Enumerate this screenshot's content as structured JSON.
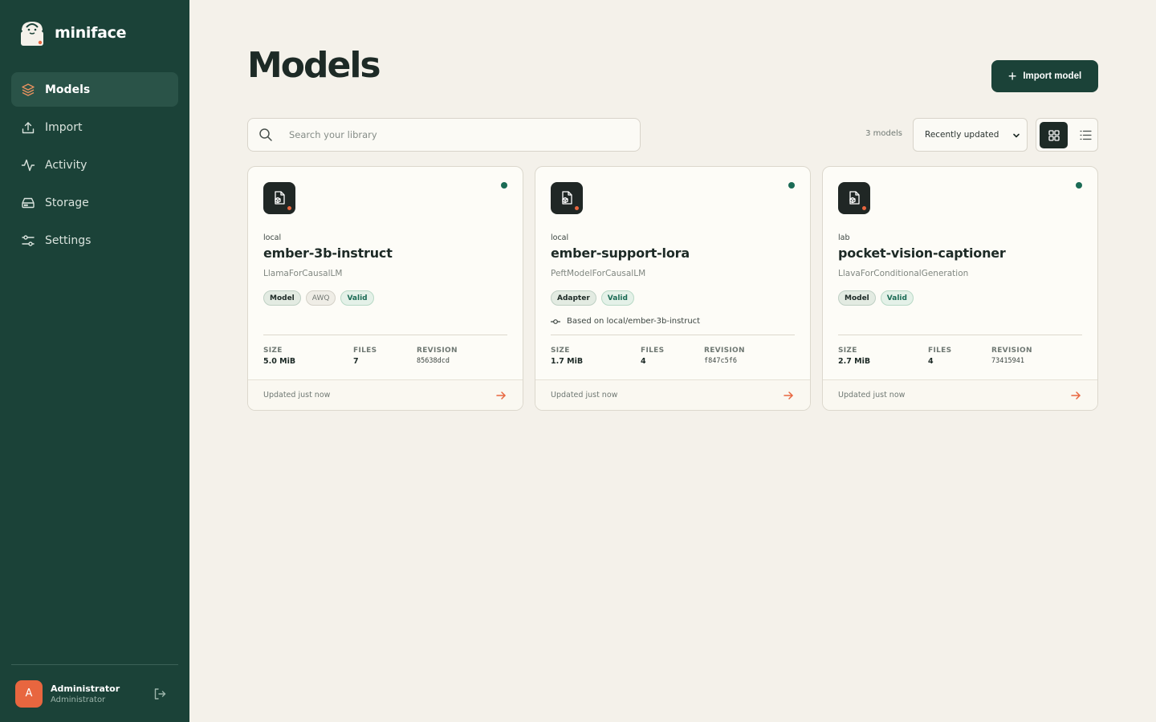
{
  "app": {
    "name": "miniface"
  },
  "sidebar": {
    "items": [
      {
        "label": "Models",
        "icon": "layers-icon",
        "active": true
      },
      {
        "label": "Import",
        "icon": "upload-icon",
        "active": false
      },
      {
        "label": "Activity",
        "icon": "activity-icon",
        "active": false
      },
      {
        "label": "Storage",
        "icon": "storage-icon",
        "active": false
      },
      {
        "label": "Settings",
        "icon": "sliders-icon",
        "active": false
      }
    ],
    "user": {
      "initial": "A",
      "name": "Administrator",
      "role": "Administrator"
    }
  },
  "header": {
    "title": "Models",
    "import_label": "Import model"
  },
  "toolbar": {
    "search_placeholder": "Search your library",
    "count": "3 models",
    "sort_selected": "Recently updated",
    "sort_options": [
      "Recently updated"
    ]
  },
  "stat_labels": {
    "size": "SIZE",
    "files": "FILES",
    "revision": "REVISION"
  },
  "cards": [
    {
      "namespace": "local",
      "name": "ember-3b-instruct",
      "arch": "LlamaForCausalLM",
      "badges": [
        "Model",
        "AWQ",
        "Valid"
      ],
      "size": "5.0 MiB",
      "files": "7",
      "revision": "85638dcd",
      "updated": "Updated just now"
    },
    {
      "namespace": "local",
      "name": "ember-support-lora",
      "arch": "PeftModelForCausalLM",
      "badges": [
        "Adapter",
        "Valid"
      ],
      "based_on": "Based on local/ember-3b-instruct",
      "size": "1.7 MiB",
      "files": "4",
      "revision": "f847c5f6",
      "updated": "Updated just now"
    },
    {
      "namespace": "lab",
      "name": "pocket-vision-captioner",
      "arch": "LlavaForConditionalGeneration",
      "badges": [
        "Model",
        "Valid"
      ],
      "size": "2.7 MiB",
      "files": "4",
      "revision": "73415941",
      "updated": "Updated just now"
    }
  ],
  "colors": {
    "sidebar": "#1b4238",
    "accent": "#e8663f",
    "status_ok": "#1b6b55",
    "background": "#f4f1ea"
  }
}
